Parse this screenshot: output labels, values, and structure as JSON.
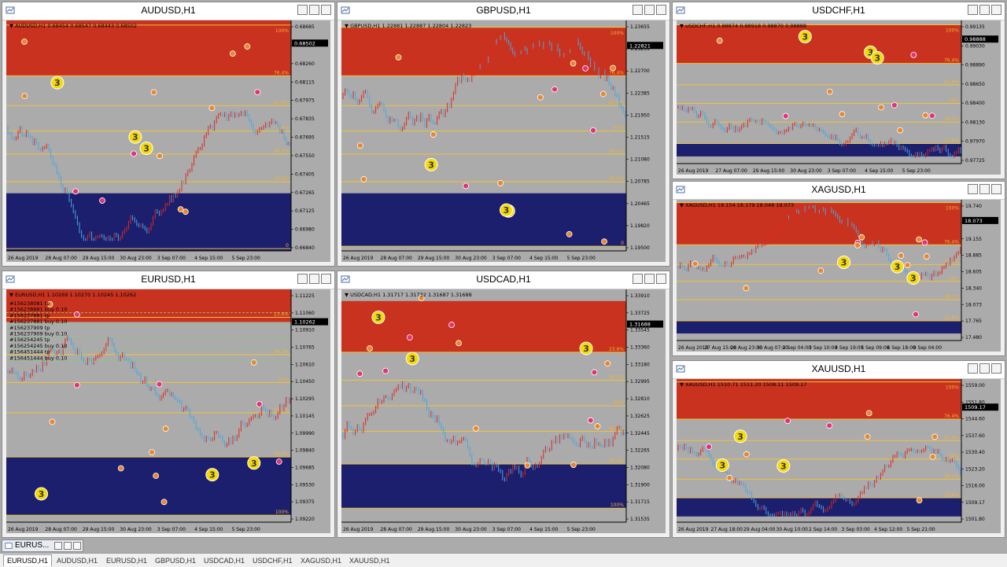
{
  "colors": {
    "red_zone": "#c8321e",
    "blue_zone": "#1b1f6e",
    "middle": "#ababab",
    "bull": "#e0281e",
    "bear": "#4aa6e0",
    "fib": "#f0c23a",
    "marker_orange": "#e8872e",
    "marker_pink": "#e0347a",
    "marker_yellow": "#f5d90a"
  },
  "window_icons": [
    "chart-window-icon",
    "minimize-icon",
    "restore-icon",
    "close-icon"
  ],
  "charts": [
    {
      "title": "AUDUSD,H1",
      "info": "AUDUSD,H1  0.68454 0.68547 0.68443 0.68502",
      "price_tag": "0.68502",
      "y_ticks": [
        "0.68685",
        "0.68480",
        "0.68260",
        "0.68115",
        "0.67975",
        "0.67835",
        "0.67695",
        "0.67550",
        "0.67405",
        "0.67265",
        "0.67125",
        "0.66980",
        "0.66840"
      ],
      "x_ticks": [
        "26 Aug 2019",
        "28 Aug 07:00",
        "29 Aug 15:00",
        "30 Aug 23:00",
        "3 Sep 07:00",
        "4 Sep 15:00",
        "5 Sep 23:00"
      ],
      "fib_labels": [
        "100%",
        "76.4%",
        "61.8%",
        "50%",
        "38.2%",
        "23.6%",
        "0"
      ],
      "extra_rows": []
    },
    {
      "title": "GBPUSD,H1",
      "info": "GBPUSD,H1  1.22881 1.22887 1.22804 1.22823",
      "price_tag": "1.22821",
      "y_ticks": [
        "1.23655",
        "1.23255",
        "1.22700",
        "1.22385",
        "1.21950",
        "1.21515",
        "1.21080",
        "1.20785",
        "1.20465",
        "1.19820",
        "1.19500"
      ],
      "x_ticks": [
        "26 Aug 2019",
        "28 Aug 07:00",
        "29 Aug 15:00",
        "30 Aug 23:00",
        "3 Sep 07:00",
        "4 Sep 15:00",
        "5 Sep 23:00"
      ],
      "fib_labels": [
        "100%",
        "76.4%",
        "61.8%",
        "50%",
        "38.2%",
        "23.6%",
        "0"
      ],
      "extra_rows": []
    },
    {
      "title": "USDCHF,H1",
      "info": "USDCHF,H1  0.98874 0.98918 0.98870 0.98888",
      "price_tag": "0.98888",
      "y_ticks": [
        "0.99135",
        "0.99030",
        "0.98890",
        "0.98650",
        "0.98400",
        "0.98130",
        "0.97970",
        "0.97725"
      ],
      "x_ticks": [
        "26 Aug 2019",
        "27 Aug 07:00",
        "29 Aug 15:00",
        "30 Aug 23:00",
        "3 Sep 07:00",
        "4 Sep 15:00",
        "5 Sep 23:00"
      ],
      "fib_labels": [
        "100%",
        "76.4%",
        "61.8%",
        "50%",
        "38.2%",
        "23.6%"
      ],
      "extra_rows": []
    },
    {
      "title": "XAGUSD,H1",
      "info": "XAGUSD,H1  18.154 18.179 18.048 18.073",
      "price_tag": "18.073",
      "y_ticks": [
        "19.740",
        "19.435",
        "19.155",
        "18.885",
        "18.605",
        "18.340",
        "18.073",
        "17.765",
        "17.480"
      ],
      "x_ticks": [
        "26 Aug 2019",
        "27 Aug 15:00",
        "28 Aug 23:00",
        "30 Aug 07:00",
        "2 Sep 04:00",
        "3 Sep 10:00",
        "4 Sep 19:00",
        "5 Sep 09:00",
        "6 Sep 18:00",
        "9 Sep 04:00"
      ],
      "fib_labels": [
        "100%",
        "76.4%",
        "61.8%",
        "50%",
        "38.2%",
        "23.6%"
      ],
      "extra_rows": []
    },
    {
      "title": "EURUSD,H1",
      "info": "EURUSD,H1  1.10269 1.10270 1.10245 1.10262",
      "price_tag": "1.10262",
      "y_ticks": [
        "1.11225",
        "1.11060",
        "1.10910",
        "1.10765",
        "1.10610",
        "1.10450",
        "1.10295",
        "1.10145",
        "1.09990",
        "1.09840",
        "1.09685",
        "1.09530",
        "1.09375",
        "1.09220"
      ],
      "x_ticks": [
        "26 Aug 2019",
        "28 Aug 07:00",
        "29 Aug 15:00",
        "30 Aug 23:00",
        "3 Sep 07:00",
        "4 Sep 15:00",
        "5 Sep 23:00"
      ],
      "fib_labels": [
        "23.6%",
        "38.2%",
        "50%",
        "61.8%",
        "76.4%",
        "100%"
      ],
      "extra_rows": [
        "#156238081 tp",
        "#156238881 buy 0.10",
        "#156237881 tp",
        "#156237881 buy 0.10",
        "#156237909 tp",
        "#156237909 buy 0.10",
        "#156254245 tp",
        "#156254245 buy 0.10",
        "#156451444 tp",
        "#156451444 buy 0.10"
      ]
    },
    {
      "title": "USDCAD,H1",
      "info": "USDCAD,H1  1.31717 1.31732 1.31687 1.31688",
      "price_tag": "1.31688",
      "y_ticks": [
        "1.33910",
        "1.33725",
        "1.33545",
        "1.33360",
        "1.33180",
        "1.32995",
        "1.32810",
        "1.32625",
        "1.32445",
        "1.32265",
        "1.32080",
        "1.31900",
        "1.31715",
        "1.31535"
      ],
      "x_ticks": [
        "26 Aug 2019",
        "28 Aug 07:00",
        "29 Aug 15:00",
        "30 Aug 23:00",
        "3 Sep 07:00",
        "4 Sep 15:00",
        "5 Sep 23:00"
      ],
      "fib_labels": [
        "23.6%",
        "38.2%",
        "50%",
        "61.8%",
        "76.4%",
        "100%"
      ],
      "extra_rows": []
    },
    {
      "title": "XAUUSD,H1",
      "info": "XAUUSD,H1  1510.71 1511.20 1508.11 1509.17",
      "price_tag": "1509.17",
      "y_ticks": [
        "1559.00",
        "1551.80",
        "1544.60",
        "1537.60",
        "1530.40",
        "1523.20",
        "1516.00",
        "1509.17",
        "1501.80"
      ],
      "x_ticks": [
        "26 Aug 2019",
        "27 Aug 18:00",
        "29 Aug 04:00",
        "30 Aug 10:00",
        "2 Sep 14:00",
        "3 Sep 03:00",
        "4 Sep 12:00",
        "5 Sep 21:00"
      ],
      "fib_labels": [
        "100%",
        "76.4%",
        "61.8%",
        "50%",
        "38.2%",
        "23.6%"
      ],
      "extra_rows": []
    }
  ],
  "minimized": {
    "label": "EURUS..."
  },
  "tabs": [
    "EURUSD,H1",
    "AUDUSD,H1",
    "EURUSD,H1",
    "GBPUSD,H1",
    "USDCAD,H1",
    "USDCHF,H1",
    "XAGUSD,H1",
    "XAUUSD,H1"
  ],
  "marker_label": "3"
}
